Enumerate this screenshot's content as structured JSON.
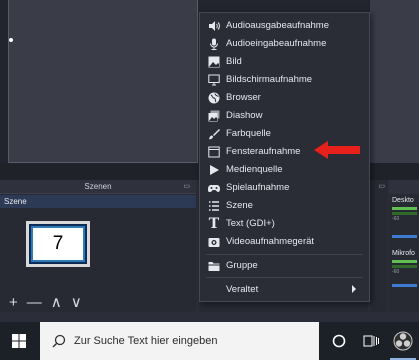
{
  "scenes_panel": {
    "title": "Szenen",
    "selected_scene": "Szene",
    "tile_number": "7",
    "toolbar": {
      "add": "+",
      "remove": "—",
      "up": "∧",
      "down": "∨"
    }
  },
  "mixer": {
    "desktop_label": "Deskto",
    "mic_label": "Mikrofo",
    "meter_tick": "-60"
  },
  "context_menu": {
    "items": [
      {
        "label": "Audioausgabeaufnahme",
        "icon": "speaker-icon"
      },
      {
        "label": "Audioeingabeaufnahme",
        "icon": "microphone-icon"
      },
      {
        "label": "Bild",
        "icon": "image-icon"
      },
      {
        "label": "Bildschirmaufnahme",
        "icon": "monitor-icon"
      },
      {
        "label": "Browser",
        "icon": "globe-icon"
      },
      {
        "label": "Diashow",
        "icon": "slideshow-icon"
      },
      {
        "label": "Farbquelle",
        "icon": "brush-icon"
      },
      {
        "label": "Fensteraufnahme",
        "icon": "window-icon"
      },
      {
        "label": "Medienquelle",
        "icon": "play-icon"
      },
      {
        "label": "Spielaufnahme",
        "icon": "gamepad-icon"
      },
      {
        "label": "Szene",
        "icon": "list-icon"
      },
      {
        "label": "Text (GDI+)",
        "icon": "text-icon"
      },
      {
        "label": "Videoaufnahmegerät",
        "icon": "camera-icon"
      },
      {
        "label": "Gruppe",
        "icon": "folder-icon"
      },
      {
        "label": "Veraltet",
        "icon": "",
        "has_submenu": true
      }
    ],
    "highlighted_item": "Fensteraufnahme"
  },
  "taskbar": {
    "search_placeholder": "Zur Suche Text hier eingeben",
    "cortana_icon": "circle-icon",
    "taskview_icon": "task-view-icon",
    "app_icon": "obs-icon"
  },
  "colors": {
    "annotation_arrow": "#e8201c",
    "menu_bg": "#2a2d36",
    "scene_row_selected": "#2d3a55"
  }
}
